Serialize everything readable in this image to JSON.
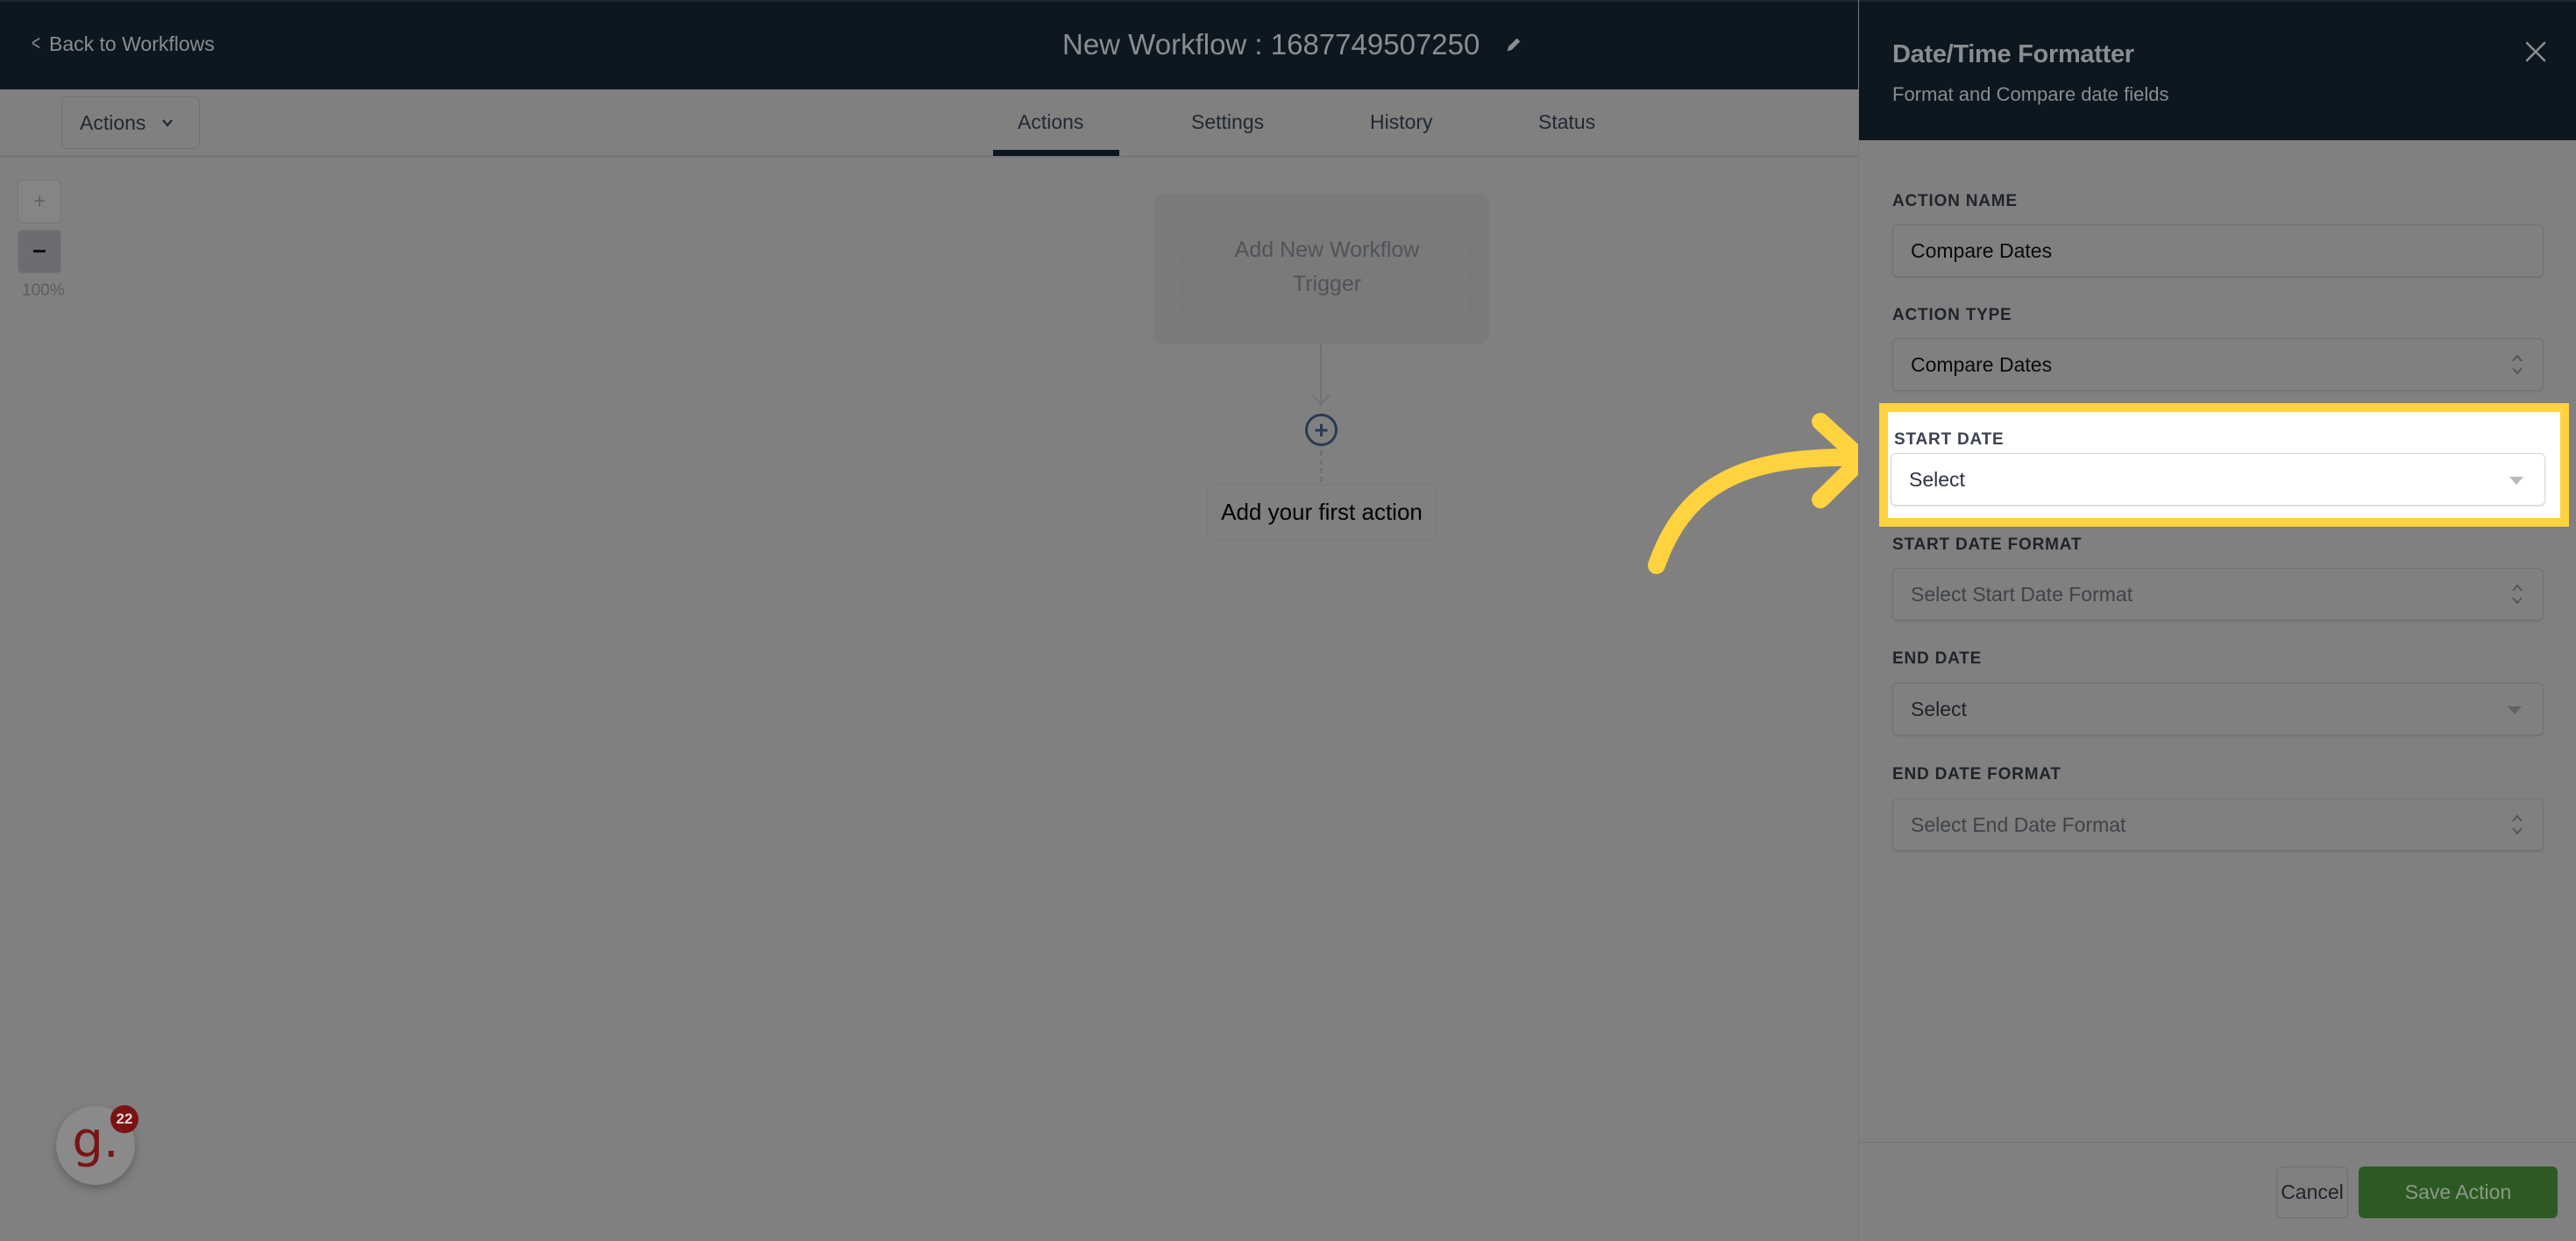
{
  "header": {
    "back_label": "Back to Workflows",
    "title": "New Workflow : 1687749507250",
    "icons": {
      "back": "chevron-left-icon",
      "edit": "pencil-icon"
    }
  },
  "toolbar": {
    "actions_dropdown_label": "Actions",
    "tabs": [
      {
        "label": "Actions",
        "active": true
      },
      {
        "label": "Settings",
        "active": false
      },
      {
        "label": "History",
        "active": false
      },
      {
        "label": "Status",
        "active": false
      }
    ]
  },
  "canvas": {
    "zoom_in_label": "+",
    "zoom_out_label": "−",
    "zoom_level": "100%",
    "trigger_label": "Add New Workflow Trigger",
    "add_step_label": "+",
    "first_action_label": "Add your first action"
  },
  "panel": {
    "title": "Date/Time Formatter",
    "subtitle": "Format and Compare date fields",
    "close_icon": "close-icon",
    "fields": [
      {
        "label": "ACTION NAME",
        "value": "Compare Dates",
        "kind": "text-input"
      },
      {
        "label": "ACTION TYPE",
        "value": "Compare Dates",
        "kind": "native-select"
      },
      {
        "label": "START DATE",
        "value": "Select",
        "kind": "dropdown",
        "highlighted": true
      },
      {
        "label": "START DATE FORMAT",
        "placeholder": "Select Start Date Format",
        "kind": "native-select"
      },
      {
        "label": "END DATE",
        "value": "Select",
        "kind": "dropdown"
      },
      {
        "label": "END DATE FORMAT",
        "placeholder": "Select End Date Format",
        "kind": "native-select"
      }
    ],
    "cancel_label": "Cancel",
    "save_label": "Save Action"
  },
  "annotation": {
    "highlight_color": "#ffd23f",
    "target": "START DATE"
  },
  "support_badge": {
    "logo": "g.",
    "count": "22",
    "color": "#7a1414"
  },
  "colors": {
    "header_bg": "#0d1720",
    "save_button": "#2d5a23",
    "overlay_gray": "#808080"
  }
}
